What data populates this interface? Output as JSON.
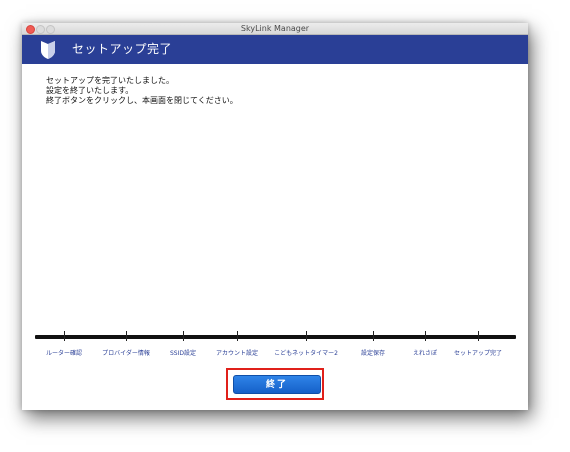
{
  "window": {
    "title": "SkyLink Manager"
  },
  "header": {
    "icon": "shield-icon",
    "title": "セットアップ完了"
  },
  "message": {
    "lines": [
      "セットアップを完了いたしました。",
      "設定を終了いたします。",
      "終了ボタンをクリックし、本画面を閉じてください。"
    ]
  },
  "steps": [
    "ルーター確認",
    "プロバイダー情報",
    "SSID設定",
    "アカウント設定",
    "こどもネットタイマー2",
    "設定保存",
    "えれさぽ",
    "セットアップ完了"
  ],
  "actions": {
    "finish_label": "終了"
  },
  "colors": {
    "header_bg": "#2a3f96",
    "button_bg": "#1f6fd9",
    "highlight_border": "#e0201a",
    "step_label": "#2a3f96"
  }
}
